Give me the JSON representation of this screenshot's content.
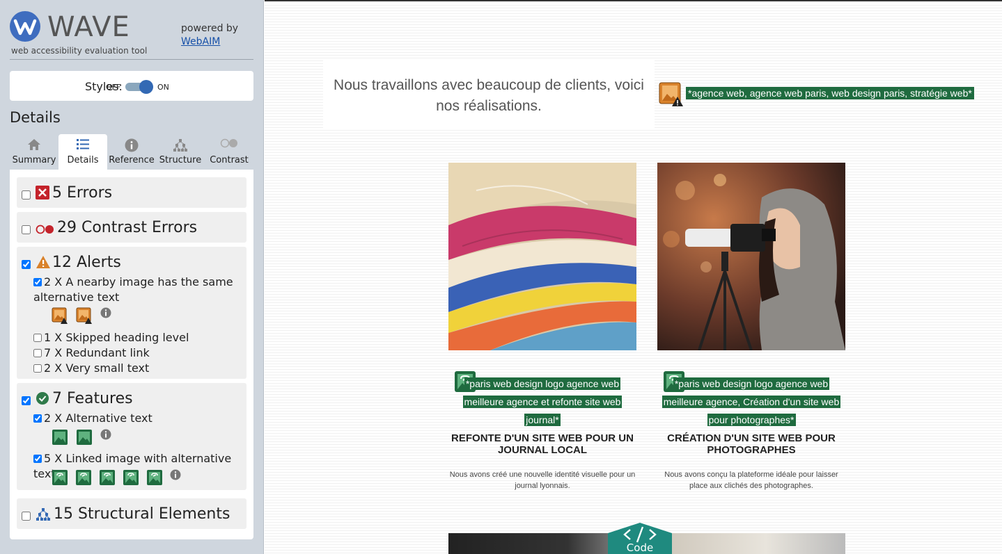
{
  "brand": {
    "name": "WAVE",
    "subtitle": "web accessibility evaluation tool",
    "powered_by": "powered by",
    "webaim_link": "WebAIM"
  },
  "styles_toggle": {
    "label": "Styles:",
    "off": "OFF",
    "on": "ON",
    "state": "on"
  },
  "details_title": "Details",
  "tabs": [
    {
      "label": "Summary",
      "icon": "home-icon",
      "active": false
    },
    {
      "label": "Details",
      "icon": "list-icon",
      "active": true
    },
    {
      "label": "Reference",
      "icon": "info-icon",
      "active": false
    },
    {
      "label": "Structure",
      "icon": "structure-icon",
      "active": false
    },
    {
      "label": "Contrast",
      "icon": "contrast-icon",
      "active": false
    }
  ],
  "groups": {
    "errors": {
      "label": "5 Errors",
      "checked": false
    },
    "contrast": {
      "label": "29 Contrast Errors",
      "checked": false
    },
    "alerts": {
      "label": "12 Alerts",
      "checked": true,
      "items": [
        {
          "label": "2 X A nearby image has the same alternative text",
          "checked": true,
          "icon_count": 2
        },
        {
          "label": "1 X Skipped heading level",
          "checked": false
        },
        {
          "label": "7 X Redundant link",
          "checked": false
        },
        {
          "label": "2 X Very small text",
          "checked": false
        }
      ]
    },
    "features": {
      "label": "7 Features",
      "checked": true,
      "items": [
        {
          "label": "2 X Alternative text",
          "checked": true,
          "icon_count": 2
        },
        {
          "label": "5 X Linked image with alternative text",
          "checked": true,
          "icon_count": 5
        }
      ]
    },
    "structure": {
      "label": "15 Structural Elements",
      "checked": false
    }
  },
  "page": {
    "hero_text": "Nous travaillons avec beaucoup de clients, voici nos réalisations.",
    "hero_alt": "*agence web, agence web paris, web design paris, stratégie web*",
    "cards": [
      {
        "alt": "*paris web design logo agence web meilleure agence et refonte site web journal*",
        "title": "REFONTE D'UN SITE WEB POUR UN JOURNAL LOCAL",
        "desc": "Nous avons créé une nouvelle identité visuelle pour un journal lyonnais."
      },
      {
        "alt": "*paris web design logo agence web meilleure agence, Création d'un site web pour photographes*",
        "title": "CRÉATION D'UN SITE WEB POUR PHOTOGRAPHES",
        "desc": "Nous avons conçu la plateforme idéale pour laisser place aux clichés des photographes."
      }
    ],
    "code_button": "Code"
  },
  "colors": {
    "accent": "#3369b4",
    "feature_green": "#1f6b3f",
    "error_red": "#c4232b",
    "alert_orange": "#d9822b",
    "sidebar_bg": "#cfd6de"
  }
}
